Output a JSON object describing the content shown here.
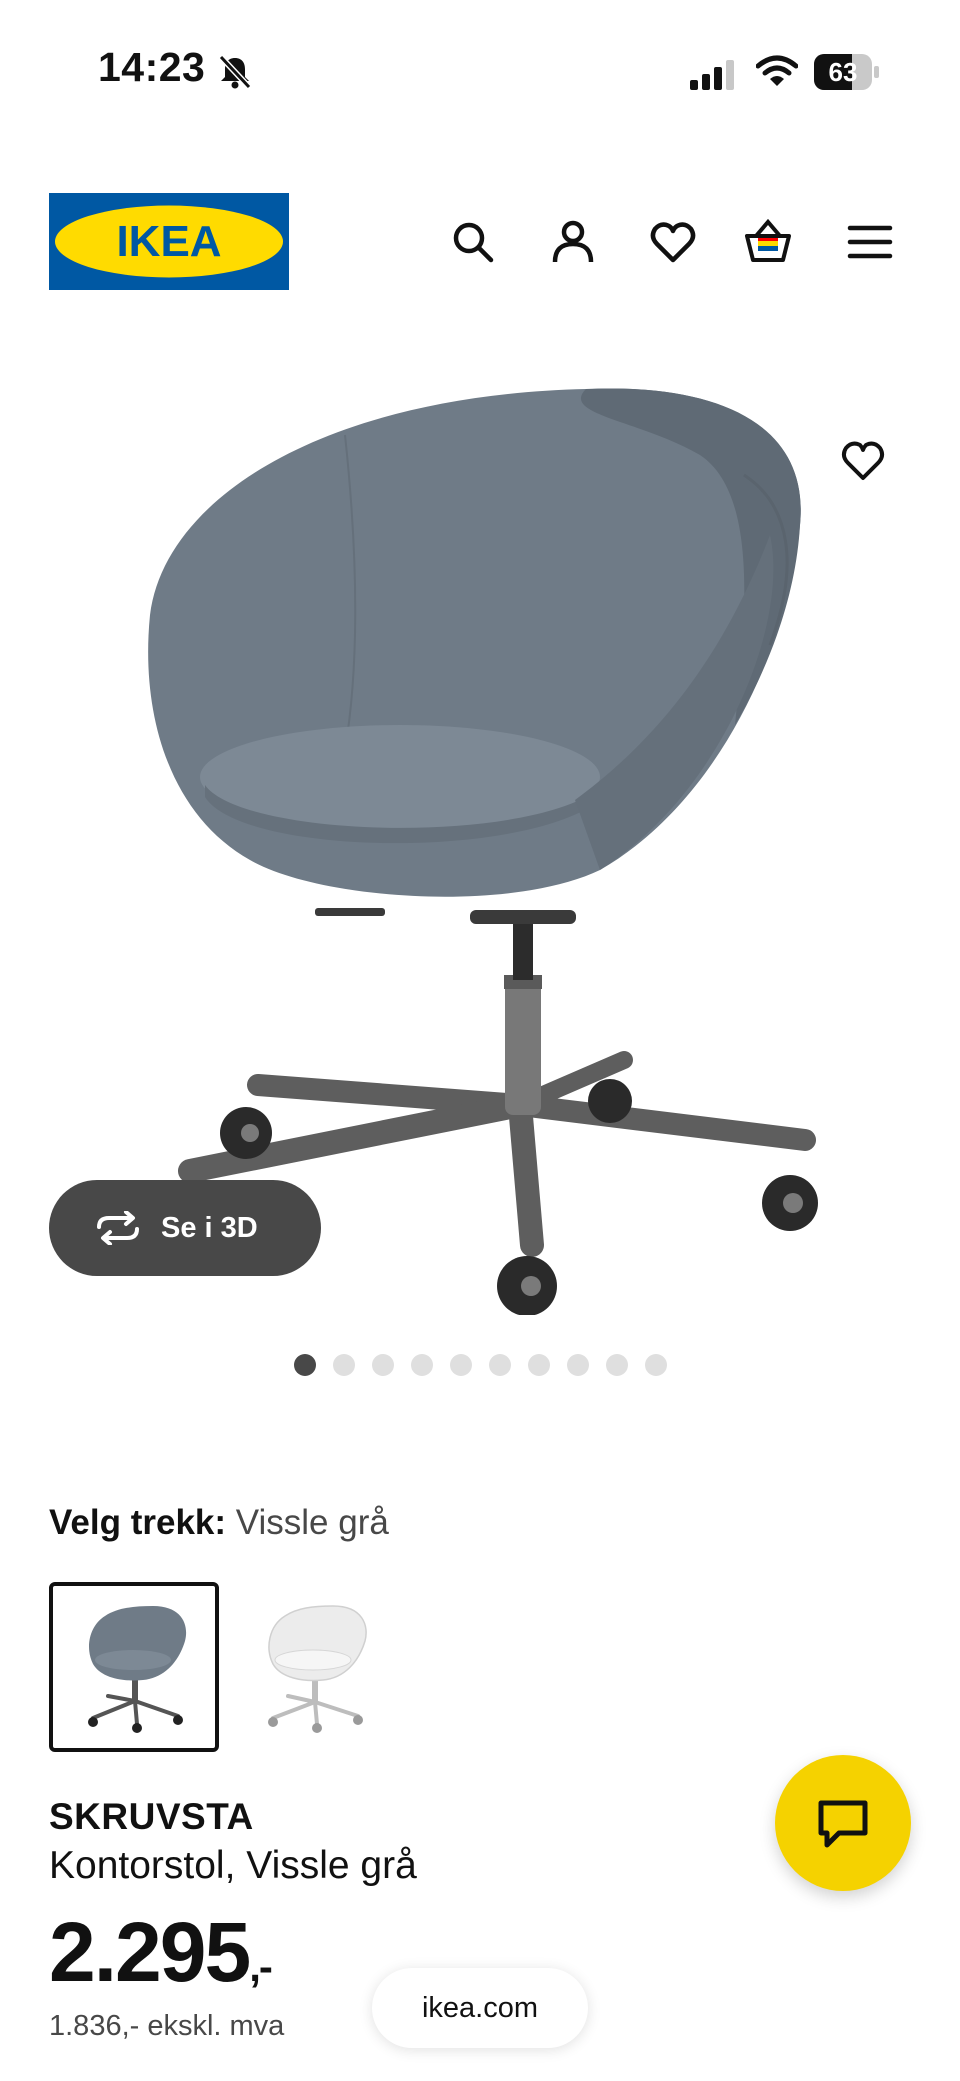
{
  "status_bar": {
    "time": "14:23",
    "battery": "63",
    "icons": [
      "bell-slash-icon",
      "signal-icon",
      "wifi-icon",
      "battery-icon"
    ]
  },
  "header": {
    "logo_text": "IKEA",
    "brand_colors": {
      "blue": "#0058a3",
      "yellow": "#ffdb00"
    },
    "icons": [
      "search-icon",
      "account-icon",
      "favorites-icon",
      "cart-icon",
      "menu-icon"
    ]
  },
  "gallery": {
    "view_3d_label": "Se i 3D",
    "image_count": 10,
    "active_index": 0,
    "favorite_icon": "heart-outline-icon"
  },
  "variant": {
    "label": "Velg trekk:",
    "value": "Vissle grå",
    "options": [
      {
        "name": "Vissle grå",
        "selected": true
      },
      {
        "name": "white",
        "selected": false
      }
    ]
  },
  "product": {
    "name": "SKRUVSTA",
    "description": "Kontorstol, Vissle grå",
    "price": "2.295",
    "price_suffix": ",-",
    "price_ex_vat": "1.836,- ekskl. mva"
  },
  "chat_button": {
    "icon": "chat-icon",
    "color": "#f5d200"
  },
  "browser": {
    "url": "ikea.com"
  }
}
